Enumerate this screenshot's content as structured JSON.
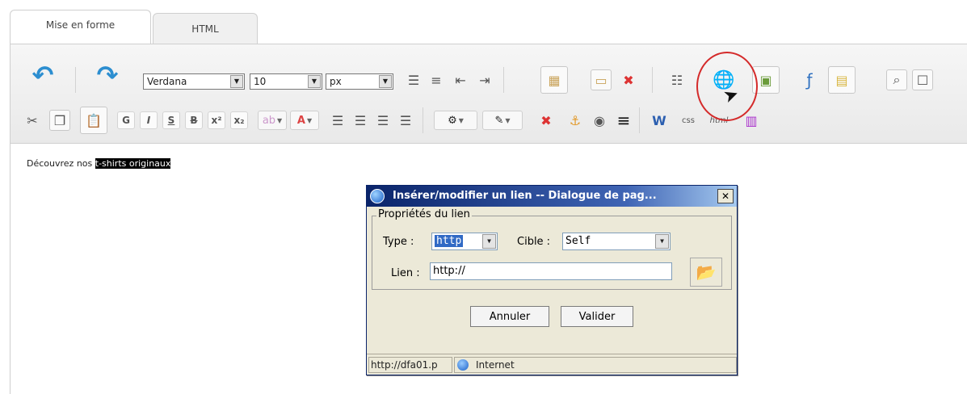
{
  "tabs": [
    {
      "label": "Mise en forme",
      "active": true
    },
    {
      "label": "HTML",
      "active": false
    }
  ],
  "toolbar": {
    "font_family": "Verdana",
    "font_size": "10",
    "font_unit": "px",
    "format_buttons": [
      "G",
      "I",
      "S",
      "B",
      "x²",
      "x₂"
    ]
  },
  "editor": {
    "text_before": "Découvrez nos ",
    "selected_text": "t-shirts originaux"
  },
  "dialog": {
    "title": "Insérer/modifier un lien -- Dialogue de pag...",
    "legend": "Propriétés du lien",
    "type_label": "Type :",
    "type_value": "http",
    "target_label": "Cible :",
    "target_value": "Self",
    "link_label": "Lien :",
    "link_value": "http://",
    "cancel_label": "Annuler",
    "submit_label": "Valider",
    "status_url": "http://dfa01.p",
    "status_zone": "Internet"
  },
  "colors": {
    "accent_blue": "#2c8ed0",
    "highlight_red": "#d42a2a",
    "titlebar": "#0a246a"
  }
}
